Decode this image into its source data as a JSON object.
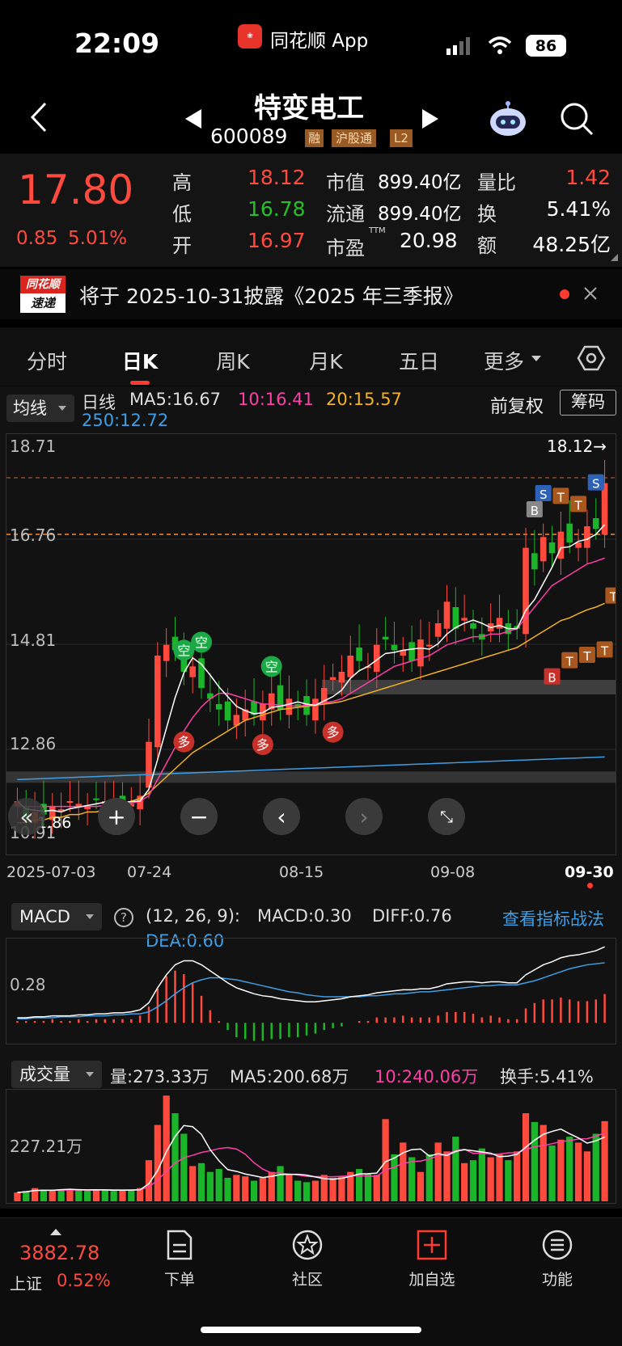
{
  "status_bar": {
    "time": "22:09",
    "app_name": "同花顺 App",
    "battery": "86"
  },
  "header": {
    "stock_name": "特变电工",
    "stock_code": "600089",
    "badges": [
      "融",
      "沪股通",
      "L2"
    ]
  },
  "quote": {
    "price": "17.80",
    "change": "0.85",
    "change_pct": "5.01%",
    "high_label": "高",
    "high": "18.12",
    "low_label": "低",
    "low": "16.78",
    "open_label": "开",
    "open": "16.97",
    "mktcap_label": "市值",
    "mktcap": "899.40亿",
    "float_label": "流通",
    "float": "899.40亿",
    "pe_label": "市盈",
    "pe_sup": "TTM",
    "pe": "20.98",
    "vol_ratio_label": "量比",
    "vol_ratio": "1.42",
    "turnover_label": "换",
    "turnover": "5.41%",
    "amount_label": "额",
    "amount": "48.25亿"
  },
  "notice": {
    "logo_top": "同花顺",
    "logo_bottom": "速递",
    "text": "将于 2025-10-31披露《2025 年三季报》"
  },
  "tabs": [
    "分时",
    "日K",
    "周K",
    "月K",
    "五日",
    "更多"
  ],
  "active_tab": "日K",
  "chart_header": {
    "selector": "均线",
    "period": "日线",
    "ma5": "MA5:16.67",
    "ma10": "10:16.41",
    "ma20": "20:15.57",
    "ma250": "250:12.72",
    "adjust": "前复权",
    "chip": "筹码"
  },
  "main_chart": {
    "y_ticks": [
      "18.71",
      "16.76",
      "14.81",
      "12.86",
      "10.91"
    ],
    "high_marker": "18.12→",
    "low_marker": "1.86",
    "x_ticks": [
      "2025-07-03",
      "07-24",
      "08-15",
      "09-08",
      "09-30"
    ],
    "signals": [
      "空",
      "空",
      "空",
      "多",
      "多",
      "多",
      "B",
      "S",
      "T",
      "T",
      "S",
      "B",
      "T",
      "T",
      "T",
      "T"
    ]
  },
  "macd": {
    "selector": "MACD",
    "params": "(12, 26, 9):",
    "macd": "MACD:0.30",
    "diff": "DIFF:0.76",
    "dea": "DEA:0.60",
    "link": "查看指标战法",
    "y_tick": "0.28"
  },
  "volume": {
    "selector": "成交量",
    "vol": "量:273.33万",
    "ma5": "MA5:200.68万",
    "ma10": "10:240.06万",
    "turnover": "换手:5.41%",
    "y_tick": "227.21万"
  },
  "bottom_nav": {
    "index_value": "3882.78",
    "index_name": "上证",
    "index_pct": "0.52%",
    "items": [
      "下单",
      "社区",
      "加自选",
      "功能"
    ]
  },
  "chart_data": {
    "type": "candlestick",
    "x_start": "2025-07-03",
    "x_end": "2025-09-30",
    "ylim": [
      10.91,
      18.71
    ],
    "closes": [
      11.9,
      11.6,
      11.7,
      11.65,
      11.8,
      11.75,
      11.9,
      11.85,
      11.8,
      11.95,
      11.9,
      11.85,
      11.9,
      11.85,
      12.0,
      13.0,
      14.6,
      14.8,
      14.7,
      14.3,
      14.4,
      14.0,
      13.8,
      13.6,
      13.4,
      13.5,
      13.6,
      13.5,
      13.7,
      13.9,
      13.6,
      13.8,
      13.7,
      13.5,
      13.8,
      14.0,
      14.2,
      14.3,
      14.6,
      14.5,
      14.4,
      14.8,
      14.9,
      14.7,
      14.7,
      14.5,
      14.9,
      14.8,
      15.2,
      15.6,
      15.1,
      15.3,
      15.1,
      14.9,
      15.2,
      15.3,
      15.0,
      15.1,
      16.6,
      16.2,
      16.8,
      16.5,
      16.9,
      16.7,
      16.7,
      17.0,
      16.95,
      17.8
    ],
    "ma10": [
      11.8,
      11.8,
      11.8,
      11.8,
      11.8,
      11.8,
      11.8,
      11.8,
      11.8,
      11.8,
      11.82,
      11.84,
      11.86,
      11.86,
      11.9,
      12.0,
      12.3,
      12.6,
      12.9,
      13.2,
      13.45,
      13.65,
      13.8,
      13.9,
      13.9,
      13.85,
      13.8,
      13.75,
      13.7,
      13.7,
      13.68,
      13.67,
      13.66,
      13.68,
      13.7,
      13.72,
      13.75,
      13.8,
      13.9,
      14.0,
      14.1,
      14.2,
      14.3,
      14.4,
      14.45,
      14.5,
      14.55,
      14.6,
      14.7,
      14.8,
      14.85,
      14.9,
      14.95,
      14.95,
      15.0,
      15.0,
      15.05,
      15.1,
      15.3,
      15.5,
      15.7,
      15.9,
      16.0,
      16.1,
      16.2,
      16.3,
      16.35,
      16.41
    ],
    "ma20": [
      11.5,
      11.5,
      11.55,
      11.55,
      11.6,
      11.6,
      11.65,
      11.65,
      11.7,
      11.7,
      11.75,
      11.8,
      11.85,
      11.9,
      11.95,
      12.05,
      12.2,
      12.35,
      12.5,
      12.65,
      12.8,
      12.9,
      13.0,
      13.1,
      13.2,
      13.3,
      13.4,
      13.45,
      13.5,
      13.55,
      13.6,
      13.62,
      13.64,
      13.66,
      13.68,
      13.7,
      13.72,
      13.75,
      13.8,
      13.85,
      13.9,
      13.95,
      14.0,
      14.05,
      14.1,
      14.15,
      14.2,
      14.25,
      14.3,
      14.35,
      14.4,
      14.45,
      14.5,
      14.55,
      14.6,
      14.65,
      14.7,
      14.75,
      14.85,
      14.95,
      15.05,
      15.15,
      15.25,
      15.3,
      15.38,
      15.45,
      15.5,
      15.57
    ],
    "ma250_start": 12.3,
    "ma250_end": 12.72,
    "volume": [
      30,
      35,
      45,
      40,
      38,
      40,
      42,
      38,
      36,
      40,
      38,
      35,
      40,
      38,
      45,
      140,
      260,
      360,
      300,
      230,
      120,
      130,
      100,
      110,
      80,
      90,
      85,
      70,
      80,
      100,
      120,
      90,
      70,
      65,
      70,
      90,
      80,
      85,
      100,
      110,
      95,
      90,
      280,
      160,
      200,
      150,
      100,
      160,
      200,
      170,
      220,
      130,
      140,
      180,
      150,
      160,
      140,
      170,
      300,
      270,
      260,
      190,
      210,
      220,
      200,
      170,
      230,
      273
    ],
    "dif": [
      0.05,
      0.05,
      0.06,
      0.06,
      0.07,
      0.07,
      0.07,
      0.08,
      0.08,
      0.09,
      0.09,
      0.1,
      0.1,
      0.11,
      0.13,
      0.2,
      0.35,
      0.48,
      0.58,
      0.62,
      0.62,
      0.58,
      0.52,
      0.46,
      0.4,
      0.35,
      0.32,
      0.29,
      0.27,
      0.26,
      0.24,
      0.23,
      0.22,
      0.21,
      0.21,
      0.22,
      0.23,
      0.24,
      0.26,
      0.27,
      0.28,
      0.3,
      0.31,
      0.32,
      0.33,
      0.33,
      0.34,
      0.34,
      0.36,
      0.39,
      0.4,
      0.41,
      0.41,
      0.4,
      0.41,
      0.41,
      0.4,
      0.4,
      0.48,
      0.53,
      0.58,
      0.61,
      0.65,
      0.67,
      0.68,
      0.7,
      0.72,
      0.76
    ],
    "dea": [
      0.04,
      0.04,
      0.05,
      0.05,
      0.05,
      0.06,
      0.06,
      0.06,
      0.07,
      0.07,
      0.07,
      0.08,
      0.08,
      0.09,
      0.09,
      0.11,
      0.16,
      0.22,
      0.29,
      0.35,
      0.4,
      0.43,
      0.45,
      0.45,
      0.44,
      0.43,
      0.41,
      0.39,
      0.37,
      0.35,
      0.33,
      0.31,
      0.3,
      0.28,
      0.27,
      0.26,
      0.26,
      0.26,
      0.26,
      0.26,
      0.27,
      0.27,
      0.28,
      0.29,
      0.29,
      0.3,
      0.31,
      0.31,
      0.32,
      0.33,
      0.34,
      0.35,
      0.36,
      0.37,
      0.37,
      0.38,
      0.38,
      0.38,
      0.4,
      0.42,
      0.45,
      0.48,
      0.51,
      0.54,
      0.56,
      0.58,
      0.59,
      0.6
    ]
  }
}
